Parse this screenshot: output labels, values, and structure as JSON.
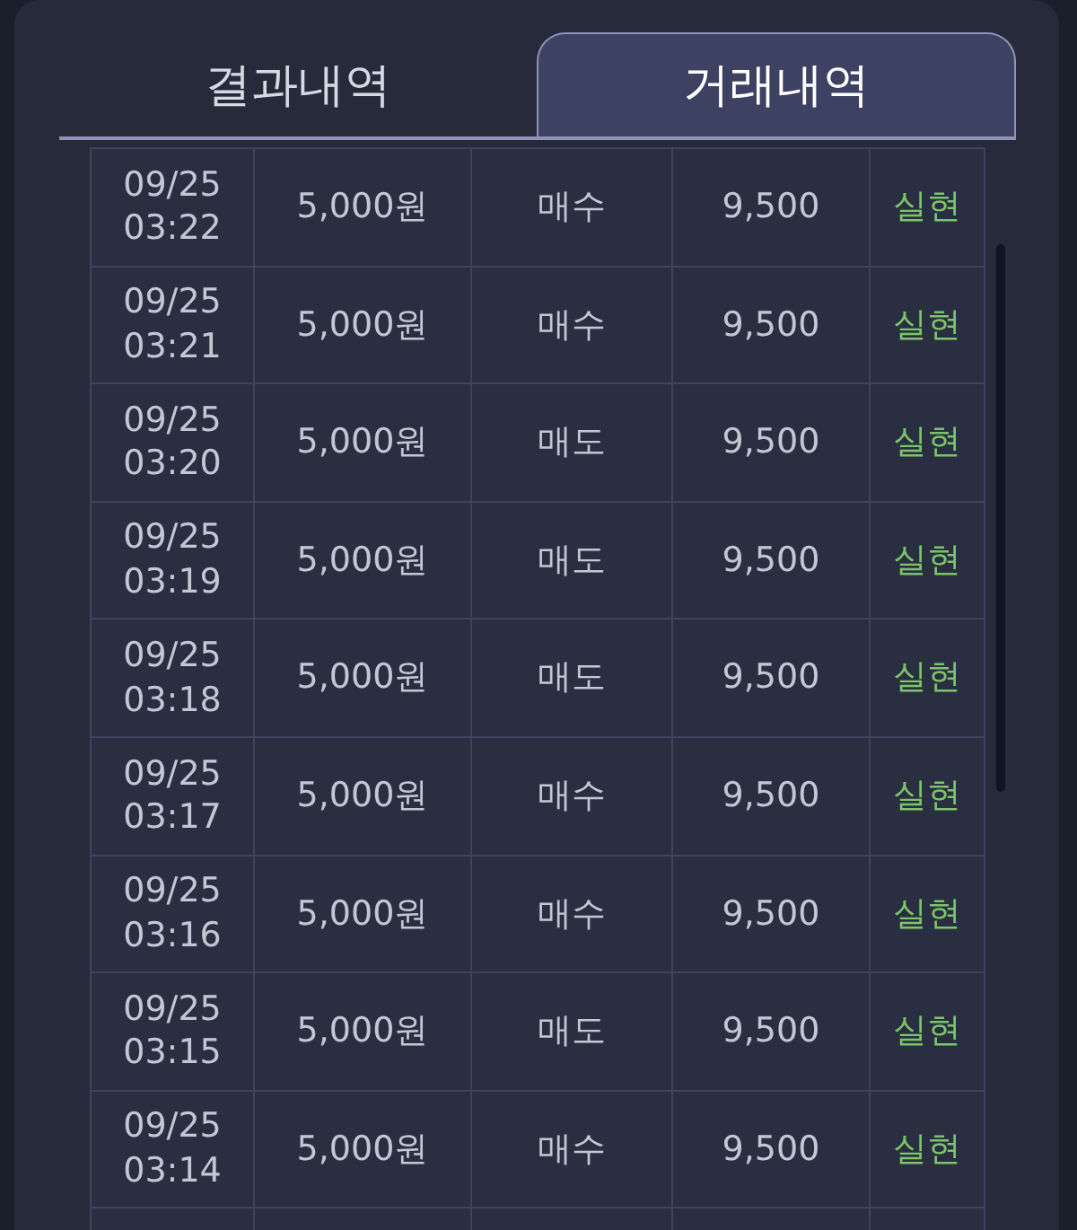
{
  "tabs": [
    {
      "label": "결과내역",
      "selected": false
    },
    {
      "label": "거래내역",
      "selected": true
    }
  ],
  "rows": [
    {
      "date": "09/25",
      "time": "03:22",
      "amount": "5,000원",
      "side": "매수",
      "price": "9,500",
      "status": "실현"
    },
    {
      "date": "09/25",
      "time": "03:21",
      "amount": "5,000원",
      "side": "매수",
      "price": "9,500",
      "status": "실현"
    },
    {
      "date": "09/25",
      "time": "03:20",
      "amount": "5,000원",
      "side": "매도",
      "price": "9,500",
      "status": "실현"
    },
    {
      "date": "09/25",
      "time": "03:19",
      "amount": "5,000원",
      "side": "매도",
      "price": "9,500",
      "status": "실현"
    },
    {
      "date": "09/25",
      "time": "03:18",
      "amount": "5,000원",
      "side": "매도",
      "price": "9,500",
      "status": "실현"
    },
    {
      "date": "09/25",
      "time": "03:17",
      "amount": "5,000원",
      "side": "매수",
      "price": "9,500",
      "status": "실현"
    },
    {
      "date": "09/25",
      "time": "03:16",
      "amount": "5,000원",
      "side": "매수",
      "price": "9,500",
      "status": "실현"
    },
    {
      "date": "09/25",
      "time": "03:15",
      "amount": "5,000원",
      "side": "매도",
      "price": "9,500",
      "status": "실현"
    },
    {
      "date": "09/25",
      "time": "03:14",
      "amount": "5,000원",
      "side": "매수",
      "price": "9,500",
      "status": "실현"
    }
  ]
}
